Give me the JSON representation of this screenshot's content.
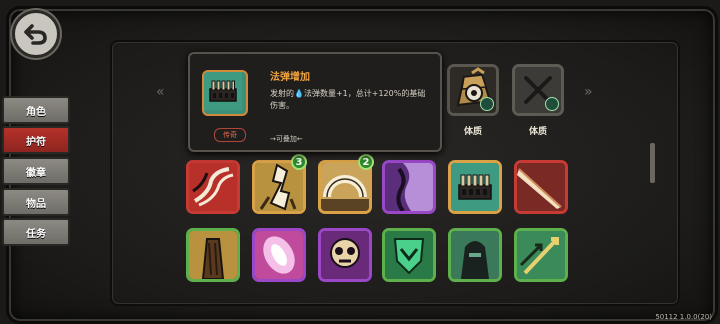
{
  "nav": {
    "items": [
      {
        "label": "角色",
        "active": false
      },
      {
        "label": "护符",
        "active": true
      },
      {
        "label": "徽章",
        "active": false
      },
      {
        "label": "物品",
        "active": false
      },
      {
        "label": "任务",
        "active": false
      }
    ]
  },
  "tooltip": {
    "title": "法弹增加",
    "desc_pre": "发射的",
    "desc_mana": "💧",
    "desc_post": "法弹数量+1，总计+120%的基础伤害。",
    "rarity": "传奇",
    "stack": "→可叠加←"
  },
  "equipped": {
    "slot1_label": "体质",
    "slot2_label": "体质"
  },
  "grid_badges": {
    "card2": "3",
    "card3": "2"
  },
  "colors": {
    "accent_red": "#c83a34",
    "accent_gold": "#d9a247",
    "accent_purple": "#9a48c8",
    "accent_green": "#5db04c",
    "title_orange": "#f0a340"
  },
  "version": "50112 1.0.0(20)"
}
